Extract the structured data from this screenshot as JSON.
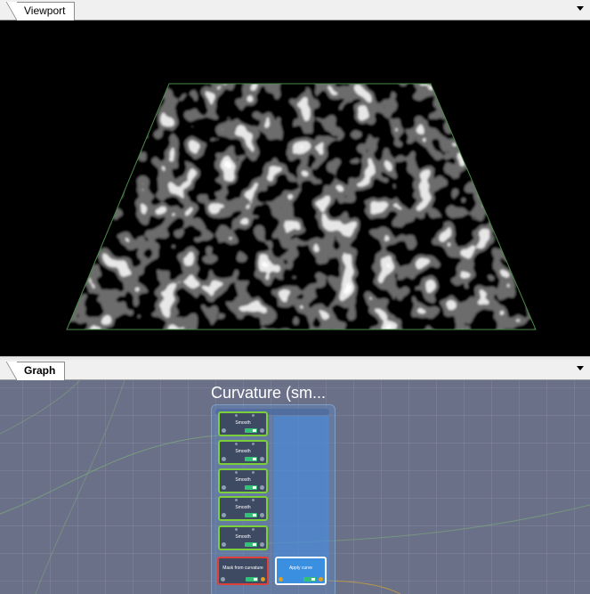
{
  "viewport_panel": {
    "tab_label": "Viewport"
  },
  "graph_panel": {
    "tab_label": "Graph",
    "frame_title": "Curvature (sm...",
    "nodes": [
      {
        "label": "Smooth"
      },
      {
        "label": "Smooth"
      },
      {
        "label": "Smooth"
      },
      {
        "label": "Smooth"
      },
      {
        "label": "Smooth"
      },
      {
        "label": "Mask from curvature"
      },
      {
        "label": "Apply curve"
      }
    ]
  },
  "colors": {
    "viewport_bg": "#000000",
    "graph_bg": "#6a7088",
    "node_active_border": "#7ccf3a",
    "node_selected_border": "#e0403a",
    "node_blue_fill": "#3b8fe0",
    "frame_fill": "#5a8cd2"
  }
}
